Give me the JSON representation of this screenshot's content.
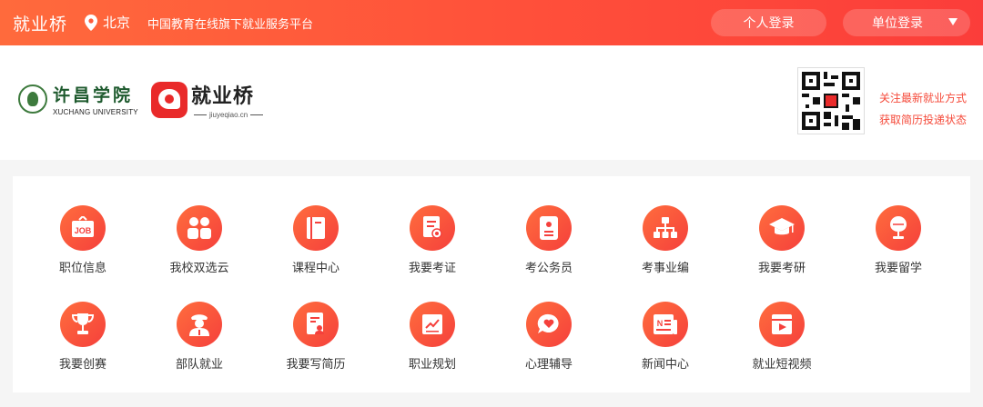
{
  "topbar": {
    "brand": "就业桥",
    "location": "北京",
    "slogan": "中国教育在线旗下就业服务平台",
    "personal_login": "个人登录",
    "org_login": "单位登录"
  },
  "header": {
    "school_name_cn": "许昌学院",
    "school_name_en": "XUCHANG UNIVERSITY",
    "jyq_name": "就业桥",
    "jyq_url": "jiuyeqiao.cn",
    "follow_line1": "关注最新就业方式",
    "follow_line2": "获取简历投递状态"
  },
  "colors": {
    "accent": "#ff5a3a",
    "accent_dark": "#f5403c",
    "follow_text": "#f54a3a"
  },
  "grid": {
    "row1": [
      {
        "label": "职位信息",
        "icon": "job-icon"
      },
      {
        "label": "我校双选云",
        "icon": "people-icon"
      },
      {
        "label": "课程中心",
        "icon": "book-icon"
      },
      {
        "label": "我要考证",
        "icon": "certificate-icon"
      },
      {
        "label": "考公务员",
        "icon": "id-card-icon"
      },
      {
        "label": "考事业编",
        "icon": "org-chart-icon"
      },
      {
        "label": "我要考研",
        "icon": "graduation-cap-icon"
      },
      {
        "label": "我要留学",
        "icon": "globe-icon"
      }
    ],
    "row2": [
      {
        "label": "我要创赛",
        "icon": "trophy-icon"
      },
      {
        "label": "部队就业",
        "icon": "soldier-icon"
      },
      {
        "label": "我要写简历",
        "icon": "resume-icon"
      },
      {
        "label": "职业规划",
        "icon": "chart-icon"
      },
      {
        "label": "心理辅导",
        "icon": "heart-chat-icon"
      },
      {
        "label": "新闻中心",
        "icon": "newspaper-icon"
      },
      {
        "label": "就业短视频",
        "icon": "video-icon"
      }
    ]
  }
}
